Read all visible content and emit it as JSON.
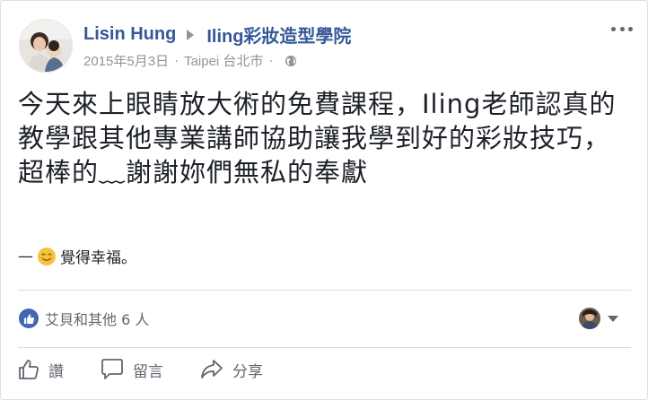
{
  "header": {
    "author_name": "Lisin Hung",
    "page_name": "Iling彩妝造型學院",
    "date": "2015年5月3日",
    "separator": "·",
    "location": "Taipei 台北市",
    "separator2": "·"
  },
  "post": {
    "text": "今天來上眼睛放大術的免費課程，Iling老師認真的教學跟其他專業講師協助讓我學到好的彩妝技巧，超棒的﹏謝謝妳們無私的奉獻",
    "feeling_dash": "—",
    "feeling_text": "覺得幸福。"
  },
  "reactions": {
    "summary": "艾貝和其他 6 人"
  },
  "actions": {
    "like_label": "讚",
    "comment_label": "留言",
    "share_label": "分享"
  },
  "colors": {
    "name_blue": "#365899",
    "meta_gray": "#90949c",
    "like_blue": "#4267b2",
    "text": "#1d2129"
  }
}
